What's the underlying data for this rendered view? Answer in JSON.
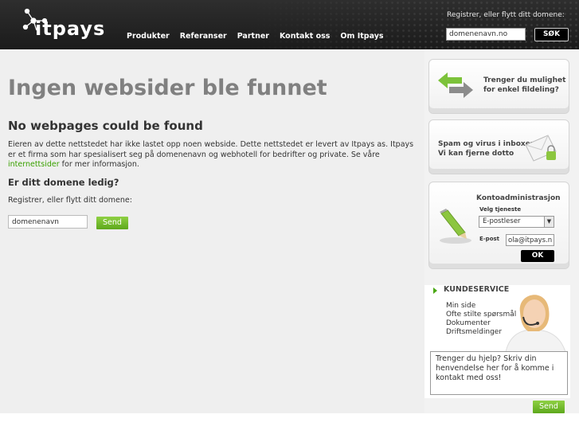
{
  "header": {
    "logo_text": "itpays",
    "nav": [
      "Produkter",
      "Referanser",
      "Partner",
      "Kontakt oss",
      "Om Itpays"
    ],
    "register_label": "Registrer, eller flytt ditt domene:",
    "search_value": "domenenavn.no",
    "search_button": "SØK"
  },
  "main": {
    "title": "Ingen websider ble funnet",
    "subtitle": "No webpages could be found",
    "paragraph_start": "Eieren av dette nettstedet har ikke lastet opp noen webside. Dette nettstedet er levert av Itpays as. Itpays er et firma som har spesialisert seg på domenenavn og webhotell for bedrifter og private. Se våre ",
    "paragraph_link": "internettsider",
    "paragraph_end": " for mer informasjon.",
    "question": "Er ditt domene ledig?",
    "register_label": "Registrer, eller flytt ditt domene:",
    "domain_value": "domenenavn",
    "send_button": "Send"
  },
  "sidebar": {
    "card1_line1": "Trenger du mulighet",
    "card1_line2": "for enkel fildeling?",
    "card2_line1": "Spam og virus i inboxen?",
    "card2_line2": "Vi kan fjerne dotto",
    "account_title": "Kontoadministrasjon",
    "service_label": "Velg tjeneste",
    "service_value": "E-postleser",
    "email_label": "E-post",
    "email_value": "ola@itpays.no",
    "ok_button": "OK",
    "support_title": "KUNDESERVICE",
    "support_links": [
      "Min side",
      "Ofte stilte spørsmål",
      "Dokumenter",
      "Driftsmeldinger"
    ],
    "help_text": "Trenger du hjelp? Skriv din henvendelse her for å komme i kontakt med oss!",
    "send_button": "Send"
  },
  "colors": {
    "link_green": "#3aa100",
    "header_bg": "#222222",
    "button_green": "#6cb825"
  }
}
